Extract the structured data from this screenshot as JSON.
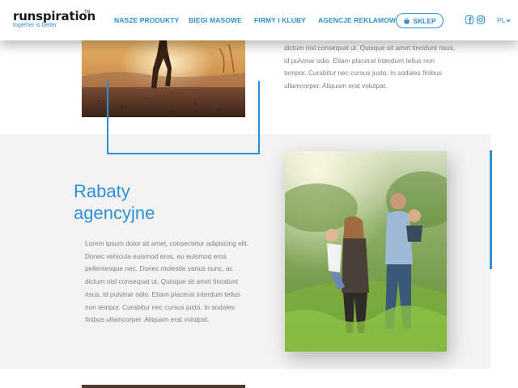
{
  "header": {
    "logo": {
      "name": "runspiration",
      "trademark": "TM",
      "tagline": "together is better"
    },
    "nav": [
      {
        "label": "NASZE PRODUKTY"
      },
      {
        "label": "BIEGI MASOWE"
      },
      {
        "label": "FIRMY I KLUBY"
      },
      {
        "label": "AGENCJE REKLAMOWE"
      }
    ],
    "shop_label": "SKLEP",
    "shop_icon": "basket-icon",
    "social": [
      "facebook-icon",
      "instagram-icon"
    ],
    "language": "PL"
  },
  "top_section": {
    "image": "runner-silhouette-sunset-photo",
    "text": "dictum nisl consequat ut. Quisque sit amet tincidunt risus, id pulvinar odio. Etiam placerat interdum tellus non tempor. Curabitur nec cursus justo. In sodales finibus ullamcorper. Aliquam erat volutpat."
  },
  "agency_section": {
    "title_line1": "Rabaty",
    "title_line2": "agencyjne",
    "text": "Lorem ipsum dolor sit amet, consectetur adipiscing elit. Donec vehicula euismod eros, eu euismod eros pellentesque nec. Donec molestie varius nunc, ac dictum nisl consequat ut. Quisque sit amet tincidunt risus, id pulvinar odio. Etiam placerat interdum tellus non tempor. Curabitur nec cursus justo. In sodales finibus ullamcorper. Aliquam erat volutpat.",
    "image": "family-walking-in-meadow-photo"
  },
  "colors": {
    "accent": "#2d8fd5",
    "section_bg": "#f3f3f3",
    "body_text": "#808080"
  }
}
